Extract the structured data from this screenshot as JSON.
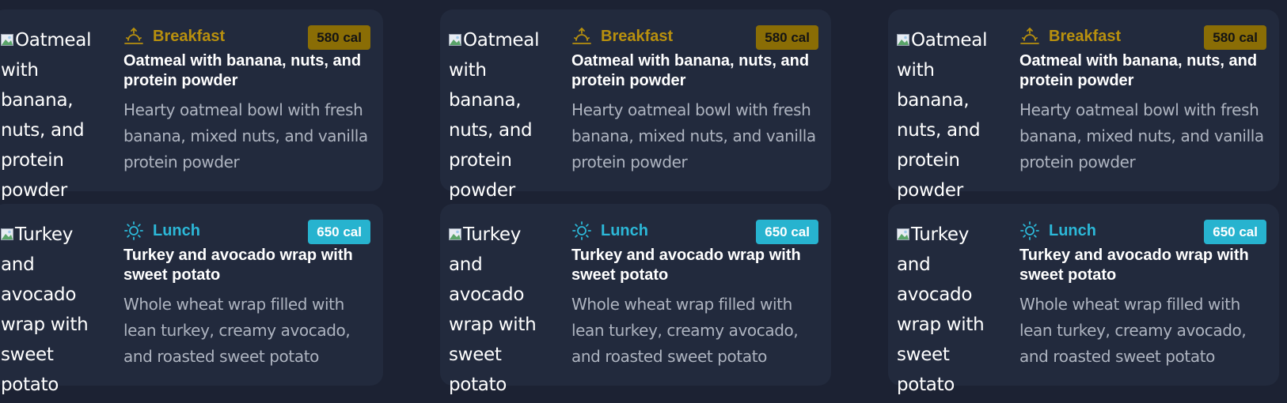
{
  "cards": [
    {
      "meal": "Breakfast",
      "calories": "580 cal",
      "image_alt": "Oatmeal with banana, nuts, and protein powder",
      "title": "Oatmeal with banana, nuts, and protein powder",
      "description": "Hearty oatmeal bowl with fresh banana, mixed nuts, and vanilla protein powder",
      "icon": "sunrise-icon",
      "accent": "#b8900e"
    },
    {
      "meal": "Breakfast",
      "calories": "580 cal",
      "image_alt": "Oatmeal with banana, nuts, and protein powder",
      "title": "Oatmeal with banana, nuts, and protein powder",
      "description": "Hearty oatmeal bowl with fresh banana, mixed nuts, and vanilla protein powder",
      "icon": "sunrise-icon",
      "accent": "#b8900e"
    },
    {
      "meal": "Breakfast",
      "calories": "580 cal",
      "image_alt": "Oatmeal with banana, nuts, and protein powder",
      "title": "Oatmeal with banana, nuts, and protein powder",
      "description": "Hearty oatmeal bowl with fresh banana, mixed nuts, and vanilla protein powder",
      "icon": "sunrise-icon",
      "accent": "#b8900e"
    },
    {
      "meal": "Lunch",
      "calories": "650 cal",
      "image_alt": "Turkey and avocado wrap with sweet potato",
      "title": "Turkey and avocado wrap with sweet potato",
      "description": "Whole wheat wrap filled with lean turkey, creamy avocado, and roasted sweet potato",
      "icon": "sun-icon",
      "accent": "#2cb8d8"
    },
    {
      "meal": "Lunch",
      "calories": "650 cal",
      "image_alt": "Turkey and avocado wrap with sweet potato",
      "title": "Turkey and avocado wrap with sweet potato",
      "description": "Whole wheat wrap filled with lean turkey, creamy avocado, and roasted sweet potato",
      "icon": "sun-icon",
      "accent": "#2cb8d8"
    },
    {
      "meal": "Lunch",
      "calories": "650 cal",
      "image_alt": "Turkey and avocado wrap with sweet potato",
      "title": "Turkey and avocado wrap with sweet potato",
      "description": "Whole wheat wrap filled with lean turkey, creamy avocado, and roasted sweet potato",
      "icon": "sun-icon",
      "accent": "#2cb8d8"
    }
  ]
}
